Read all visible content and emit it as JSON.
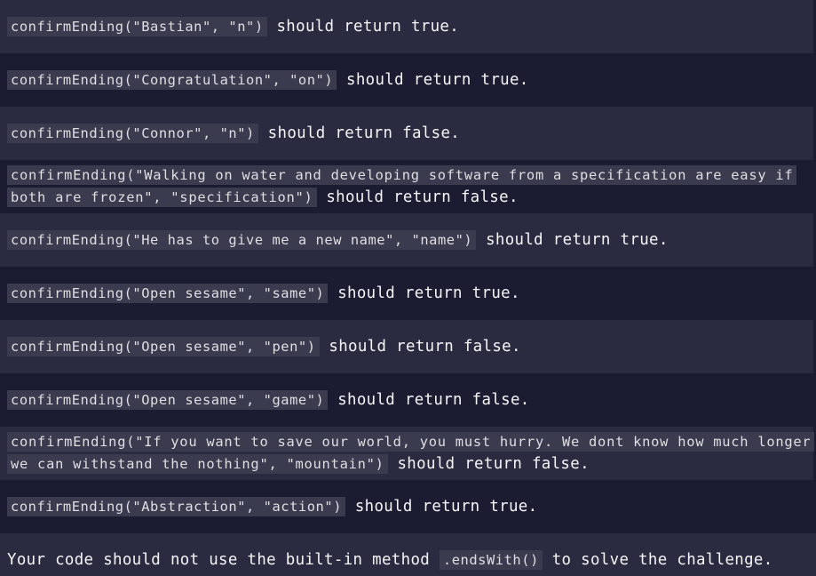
{
  "tests": [
    {
      "code": "confirmEnding(\"Bastian\", \"n\")",
      "result": " should return true."
    },
    {
      "code": "confirmEnding(\"Congratulation\", \"on\")",
      "result": " should return true."
    },
    {
      "code": "confirmEnding(\"Connor\", \"n\")",
      "result": " should return false."
    },
    {
      "code": "confirmEnding(\"Walking on water and developing software from a specification are easy if both are frozen\", \"specification\")",
      "result": " should return false."
    },
    {
      "code": "confirmEnding(\"He has to give me a new name\", \"name\")",
      "result": " should return true."
    },
    {
      "code": "confirmEnding(\"Open sesame\", \"same\")",
      "result": " should return true."
    },
    {
      "code": "confirmEnding(\"Open sesame\", \"pen\")",
      "result": " should return false."
    },
    {
      "code": "confirmEnding(\"Open sesame\", \"game\")",
      "result": " should return false."
    },
    {
      "code": "confirmEnding(\"If you want to save our world, you must hurry. We dont know how much longer we can withstand the nothing\", \"mountain\")",
      "result": " should return false."
    },
    {
      "code": "confirmEnding(\"Abstraction\", \"action\")",
      "result": " should return true."
    }
  ],
  "note": {
    "before": "Your code should not use the built-in method ",
    "code": ".endsWith()",
    "after": " to solve the challenge."
  }
}
